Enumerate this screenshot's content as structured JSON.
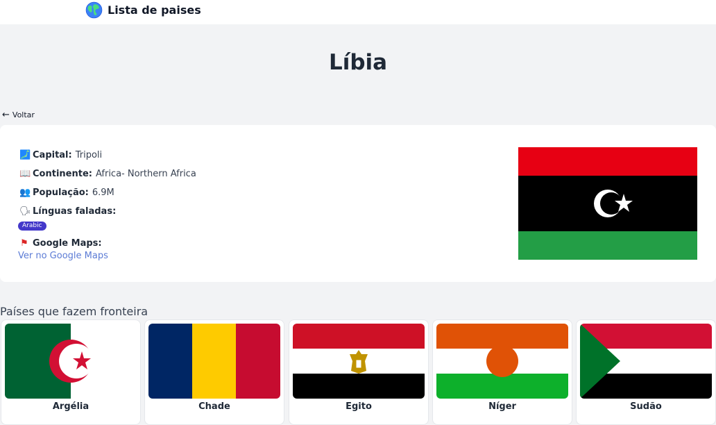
{
  "header": {
    "brand": "Lista de paises",
    "brand_icon": "globe-icon"
  },
  "page": {
    "title": "Líbia",
    "back_label": "Voltar"
  },
  "details": {
    "capital_label": "Capital:",
    "capital_value": "Tripoli",
    "continent_label": "Continente:",
    "continent_value": "Africa- Northern Africa",
    "population_label": "População:",
    "population_value": "6.9M",
    "languages_label": "Línguas faladas:",
    "languages": [
      "Arabic"
    ],
    "maps_label": "Google Maps:",
    "maps_link": "Ver no Google Maps",
    "icons": [
      "map-icon",
      "book-icon",
      "people-icon",
      "speaking-head-icon",
      "flag-icon"
    ]
  },
  "borders": {
    "heading": "Países que fazem fronteira",
    "countries": [
      "Argélia",
      "Chade",
      "Egito",
      "Níger",
      "Sudão"
    ]
  },
  "colors": {
    "libya_red": "#e70013",
    "libya_green": "#239e46",
    "badge": "#4338ca",
    "link": "#5b7bd5",
    "page_bg": "#f2f3f5"
  }
}
